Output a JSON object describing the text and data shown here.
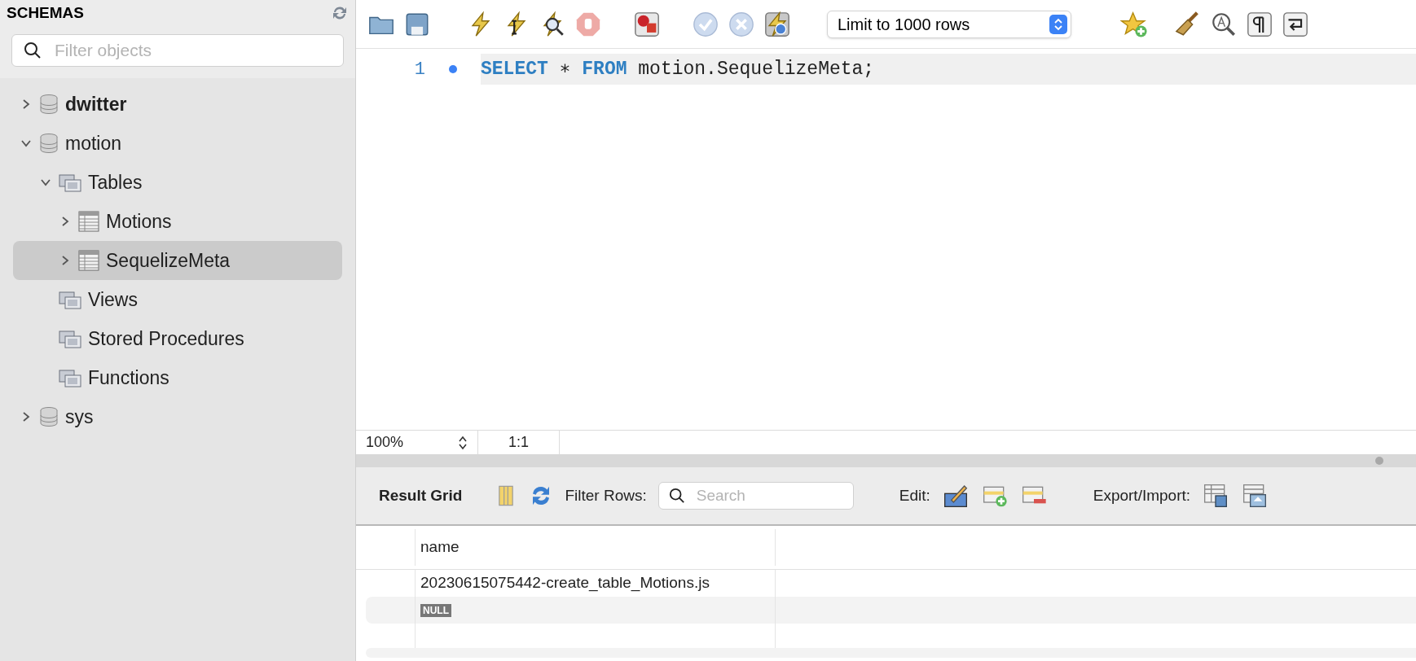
{
  "sidebar": {
    "title": "SCHEMAS",
    "filter": {
      "placeholder": "Filter objects"
    },
    "tree": [
      {
        "kind": "schema",
        "label": "dwitter",
        "default_schema": true,
        "expanded": false,
        "selected": false
      },
      {
        "kind": "schema",
        "label": "motion",
        "default_schema": false,
        "expanded": true,
        "selected": false,
        "children": [
          {
            "kind": "folder",
            "label": "Tables",
            "expanded": true,
            "selected": false,
            "children": [
              {
                "kind": "table",
                "label": "Motions",
                "expanded": false,
                "selected": false
              },
              {
                "kind": "table",
                "label": "SequelizeMeta",
                "expanded": false,
                "selected": true
              }
            ]
          },
          {
            "kind": "folder",
            "label": "Views",
            "selected": false
          },
          {
            "kind": "folder",
            "label": "Stored Procedures",
            "selected": false
          },
          {
            "kind": "folder",
            "label": "Functions",
            "selected": false
          }
        ]
      },
      {
        "kind": "schema",
        "label": "sys",
        "default_schema": false,
        "expanded": false,
        "selected": false
      }
    ]
  },
  "toolbar": {
    "limit_select": "Limit to 1000 rows"
  },
  "editor": {
    "lines": [
      {
        "number": "1",
        "tokens": [
          {
            "kind": "keyword",
            "text": "SELECT"
          },
          {
            "kind": "plain",
            "text": " ∗ "
          },
          {
            "kind": "keyword",
            "text": "FROM"
          },
          {
            "kind": "plain",
            "text": " motion.SequelizeMeta;"
          }
        ]
      }
    ],
    "status": {
      "zoom": "100%",
      "position": "1:1"
    }
  },
  "results": {
    "title": "Result Grid",
    "filter_label": "Filter Rows:",
    "search": {
      "placeholder": "Search"
    },
    "edit_label": "Edit:",
    "export_label": "Export/Import:",
    "columns": [
      "name"
    ],
    "rows": [
      {
        "kind": "text",
        "value": "20230615075442-create_table_Motions.js"
      },
      {
        "kind": "null",
        "value": "NULL"
      }
    ]
  }
}
